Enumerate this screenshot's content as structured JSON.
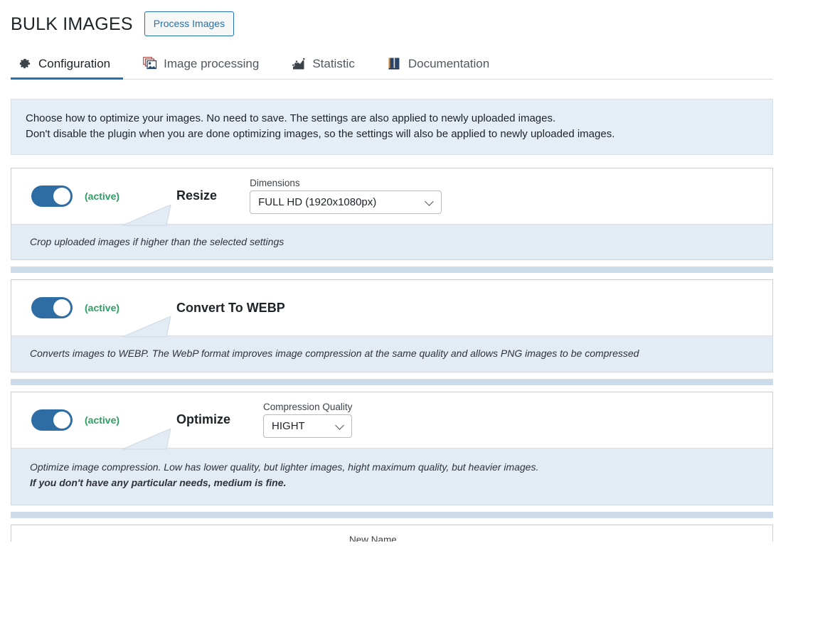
{
  "header": {
    "title": "BULK IMAGES",
    "process_button": "Process Images"
  },
  "tabs": [
    {
      "label": "Configuration",
      "icon": "gear-icon",
      "active": true
    },
    {
      "label": "Image processing",
      "icon": "images-icon",
      "active": false
    },
    {
      "label": "Statistic",
      "icon": "chart-icon",
      "active": false
    },
    {
      "label": "Documentation",
      "icon": "book-icon",
      "active": false
    }
  ],
  "notice": {
    "line1": "Choose how to optimize your images. No need to save. The settings are also applied to newly uploaded images.",
    "line2": "Don't disable the plugin when you are done optimizing images, so the settings will also be applied to newly uploaded images."
  },
  "settings": [
    {
      "toggle_state": "on",
      "state_label": "(active)",
      "name": "Resize",
      "field_label": "Dimensions",
      "field_value": "FULL HD (1920x1080px)",
      "description_line1": "Crop uploaded images if higher than the selected settings",
      "description_line2": ""
    },
    {
      "toggle_state": "on",
      "state_label": "(active)",
      "name": "Convert To WEBP",
      "field_label": "",
      "field_value": "",
      "description_line1": "Converts images to WEBP. The WebP format improves image compression at the same quality and allows PNG images to be compressed",
      "description_line2": ""
    },
    {
      "toggle_state": "on",
      "state_label": "(active)",
      "name": "Optimize",
      "field_label": "Compression Quality",
      "field_value": "HIGHT",
      "description_line1": "Optimize image compression. Low has lower quality, but lighter images, hight maximum quality, but heavier images.",
      "description_line2": "If you don't have any particular needs, medium is fine."
    }
  ],
  "partial_bottom_card": {
    "field_label": "New Name"
  },
  "colors": {
    "accent": "#2271b1",
    "toggle_on": "#2d6da4",
    "active_text": "#2e9e63",
    "notice_bg": "#e5eef6",
    "desc_bg": "#e3ecf4",
    "gap_bar": "#cddceb"
  }
}
